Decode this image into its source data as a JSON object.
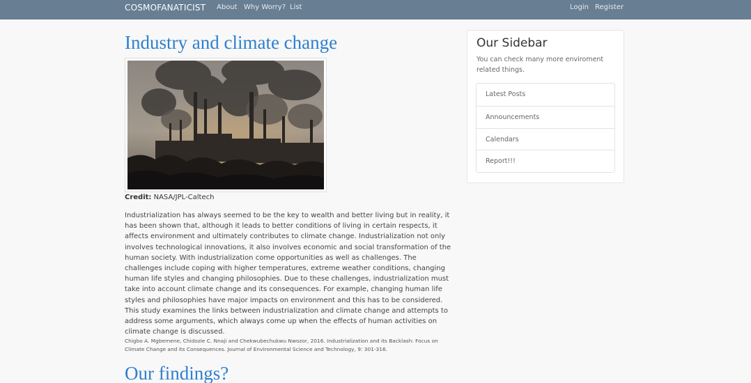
{
  "navbar": {
    "brand": "COSMOFANATICIST",
    "links": [
      "About",
      "Why Worry?",
      "List"
    ],
    "login": "Login",
    "register": "Register"
  },
  "article": {
    "title": "Industry and climate change",
    "image_alt": "Industrial smokestacks emitting smoke",
    "credit_label": "Credit:",
    "credit_value": " NASA/JPL-Caltech",
    "body": "Industrialization has always seemed to be the key to wealth and better living but in reality, it has been shown that, although it leads to better conditions of living in certain respects, it affects environment and ultimately contributes to climate change. Industrialization not only involves technological innovations, it also involves economic and social transformation of the human society. With industrialization come opportunities as well as challenges. The challenges include coping with higher temperatures, extreme weather conditions, changing human life styles and changing philosophies. Due to these challenges, industrialization must take into account climate change and its consequences. For example, changing human life styles and philosophies have major impacts on environment and this has to be considered. This study examines the links between industrialization and climate change and attempts to address some arguments, which always come up when the effects of human activities on climate change is discussed.",
    "citation": "Chigbo A. Mgbemene, Chidozie C. Nnaji and Chekwubechukwu Nwozor, 2016. Industrialization and its Backlash: Focus on Climate Change and its Consequences. Journal of Environmental Science and Technology, 9: 301-316.",
    "next_heading": "Our findings?"
  },
  "sidebar": {
    "title": "Our Sidebar",
    "description": "You can check many more enviroment related things.",
    "items": [
      "Latest Posts",
      "Announcements",
      "Calendars",
      "Report!!!"
    ]
  },
  "colors": {
    "navbar": "#677e93",
    "heading": "#2d7fcf",
    "background": "#f8f8f8"
  }
}
